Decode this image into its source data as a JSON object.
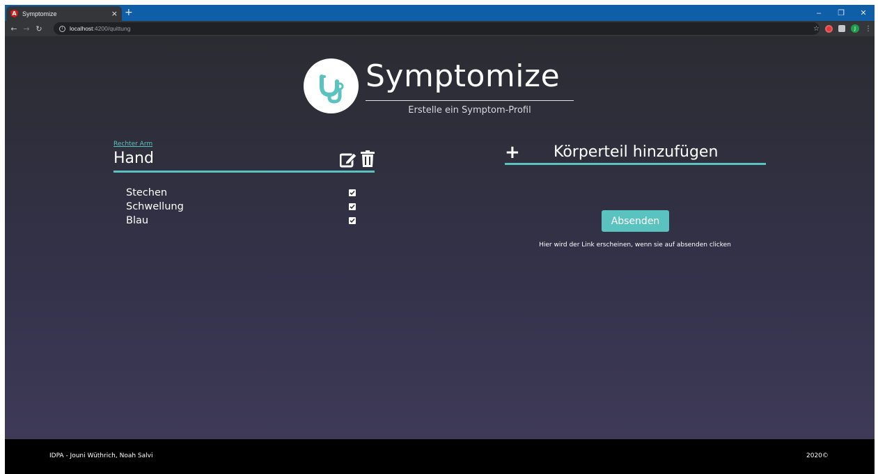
{
  "browser": {
    "tab_title": "Symptomize",
    "tab_close": "×",
    "new_tab": "+",
    "url_host": "localhost",
    "url_path": ":4200/quittung",
    "avatar_letter": "J",
    "window_controls": {
      "minimize": "–",
      "restore": "❐",
      "close": "✕"
    },
    "icons": [
      "back-icon",
      "forward-icon",
      "reload-icon",
      "info-icon",
      "star-icon",
      "extension-icon",
      "puzzle-icon",
      "menu-icon"
    ]
  },
  "brand": {
    "name": "Symptomize",
    "tagline": "Erstelle ein Symptom-Profil",
    "accent_color": "#5bc3bf"
  },
  "body_part": {
    "breadcrumb": "Rechter Arm",
    "title": "Hand",
    "symptoms": [
      {
        "label": "Stechen",
        "checked": true
      },
      {
        "label": "Schwellung",
        "checked": true
      },
      {
        "label": "Blau",
        "checked": true
      }
    ]
  },
  "actions": {
    "add_symbol": "+",
    "add_part_label": "Körperteil hinzufügen",
    "submit_label": "Absenden",
    "link_hint": "Hier wird der Link erscheinen, wenn sie auf absenden clicken"
  },
  "footer": {
    "credits": "IDPA - Jouni Wüthrich, Noah Salvi",
    "year": "2020©"
  }
}
